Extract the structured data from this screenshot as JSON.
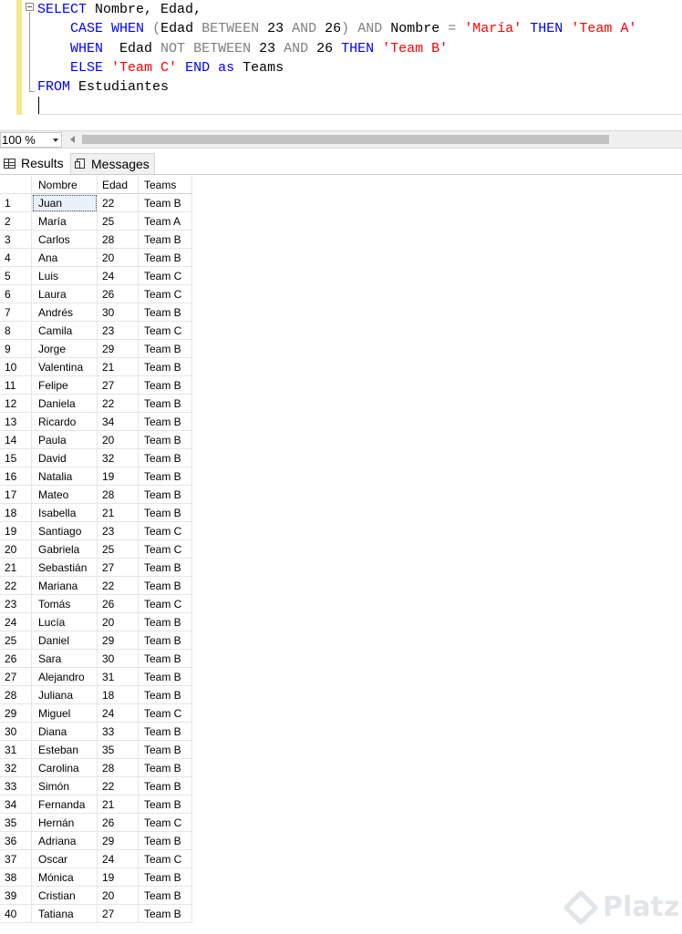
{
  "editor": {
    "lines": [
      [
        {
          "t": "SELECT",
          "c": "kw"
        },
        {
          "t": " Nombre"
        },
        {
          "t": ","
        },
        {
          "t": " Edad"
        },
        {
          "t": ","
        }
      ],
      [
        {
          "t": "    "
        },
        {
          "t": "CASE",
          "c": "kw"
        },
        {
          "t": " "
        },
        {
          "t": "WHEN",
          "c": "kw"
        },
        {
          "t": " "
        },
        {
          "t": "(",
          "c": "gr"
        },
        {
          "t": "Edad "
        },
        {
          "t": "BETWEEN",
          "c": "gr"
        },
        {
          "t": " 23 "
        },
        {
          "t": "AND",
          "c": "gr"
        },
        {
          "t": " 26"
        },
        {
          "t": ")",
          "c": "gr"
        },
        {
          "t": " "
        },
        {
          "t": "AND",
          "c": "gr"
        },
        {
          "t": " Nombre "
        },
        {
          "t": "=",
          "c": "gr"
        },
        {
          "t": " "
        },
        {
          "t": "'María'",
          "c": "st"
        },
        {
          "t": " "
        },
        {
          "t": "THEN",
          "c": "kw"
        },
        {
          "t": " "
        },
        {
          "t": "'Team A'",
          "c": "st"
        }
      ],
      [
        {
          "t": "    "
        },
        {
          "t": "WHEN",
          "c": "kw"
        },
        {
          "t": "  Edad "
        },
        {
          "t": "NOT",
          "c": "gr"
        },
        {
          "t": " "
        },
        {
          "t": "BETWEEN",
          "c": "gr"
        },
        {
          "t": " 23 "
        },
        {
          "t": "AND",
          "c": "gr"
        },
        {
          "t": " 26 "
        },
        {
          "t": "THEN",
          "c": "kw"
        },
        {
          "t": " "
        },
        {
          "t": "'Team B'",
          "c": "st"
        }
      ],
      [
        {
          "t": "    "
        },
        {
          "t": "ELSE",
          "c": "kw"
        },
        {
          "t": " "
        },
        {
          "t": "'Team C'",
          "c": "st"
        },
        {
          "t": " "
        },
        {
          "t": "END",
          "c": "kw"
        },
        {
          "t": " "
        },
        {
          "t": "as",
          "c": "kw"
        },
        {
          "t": " Teams"
        }
      ],
      [
        {
          "t": "FROM",
          "c": "kw"
        },
        {
          "t": " Estudiantes"
        }
      ]
    ]
  },
  "zoom": {
    "value": "100 %"
  },
  "tabs": {
    "results": "Results",
    "messages": "Messages"
  },
  "results": {
    "columns": [
      "Nombre",
      "Edad",
      "Teams"
    ],
    "rows": [
      [
        "1",
        "Juan",
        "22",
        "Team B"
      ],
      [
        "2",
        "María",
        "25",
        "Team A"
      ],
      [
        "3",
        "Carlos",
        "28",
        "Team B"
      ],
      [
        "4",
        "Ana",
        "20",
        "Team B"
      ],
      [
        "5",
        "Luis",
        "24",
        "Team C"
      ],
      [
        "6",
        "Laura",
        "26",
        "Team C"
      ],
      [
        "7",
        "Andrés",
        "30",
        "Team B"
      ],
      [
        "8",
        "Camila",
        "23",
        "Team C"
      ],
      [
        "9",
        "Jorge",
        "29",
        "Team B"
      ],
      [
        "10",
        "Valentina",
        "21",
        "Team B"
      ],
      [
        "11",
        "Felipe",
        "27",
        "Team B"
      ],
      [
        "12",
        "Daniela",
        "22",
        "Team B"
      ],
      [
        "13",
        "Ricardo",
        "34",
        "Team B"
      ],
      [
        "14",
        "Paula",
        "20",
        "Team B"
      ],
      [
        "15",
        "David",
        "32",
        "Team B"
      ],
      [
        "16",
        "Natalia",
        "19",
        "Team B"
      ],
      [
        "17",
        "Mateo",
        "28",
        "Team B"
      ],
      [
        "18",
        "Isabella",
        "21",
        "Team B"
      ],
      [
        "19",
        "Santiago",
        "23",
        "Team C"
      ],
      [
        "20",
        "Gabriela",
        "25",
        "Team C"
      ],
      [
        "21",
        "Sebastián",
        "27",
        "Team B"
      ],
      [
        "22",
        "Mariana",
        "22",
        "Team B"
      ],
      [
        "23",
        "Tomás",
        "26",
        "Team C"
      ],
      [
        "24",
        "Lucía",
        "20",
        "Team B"
      ],
      [
        "25",
        "Daniel",
        "29",
        "Team B"
      ],
      [
        "26",
        "Sara",
        "30",
        "Team B"
      ],
      [
        "27",
        "Alejandro",
        "31",
        "Team B"
      ],
      [
        "28",
        "Juliana",
        "18",
        "Team B"
      ],
      [
        "29",
        "Miguel",
        "24",
        "Team C"
      ],
      [
        "30",
        "Diana",
        "33",
        "Team B"
      ],
      [
        "31",
        "Esteban",
        "35",
        "Team B"
      ],
      [
        "32",
        "Carolina",
        "28",
        "Team B"
      ],
      [
        "33",
        "Simón",
        "22",
        "Team B"
      ],
      [
        "34",
        "Fernanda",
        "21",
        "Team B"
      ],
      [
        "35",
        "Hernán",
        "26",
        "Team C"
      ],
      [
        "36",
        "Adriana",
        "29",
        "Team B"
      ],
      [
        "37",
        "Oscar",
        "24",
        "Team C"
      ],
      [
        "38",
        "Mónica",
        "19",
        "Team B"
      ],
      [
        "39",
        "Cristian",
        "20",
        "Team B"
      ],
      [
        "40",
        "Tatiana",
        "27",
        "Team B"
      ]
    ]
  },
  "watermark": {
    "text": "Platzi"
  }
}
